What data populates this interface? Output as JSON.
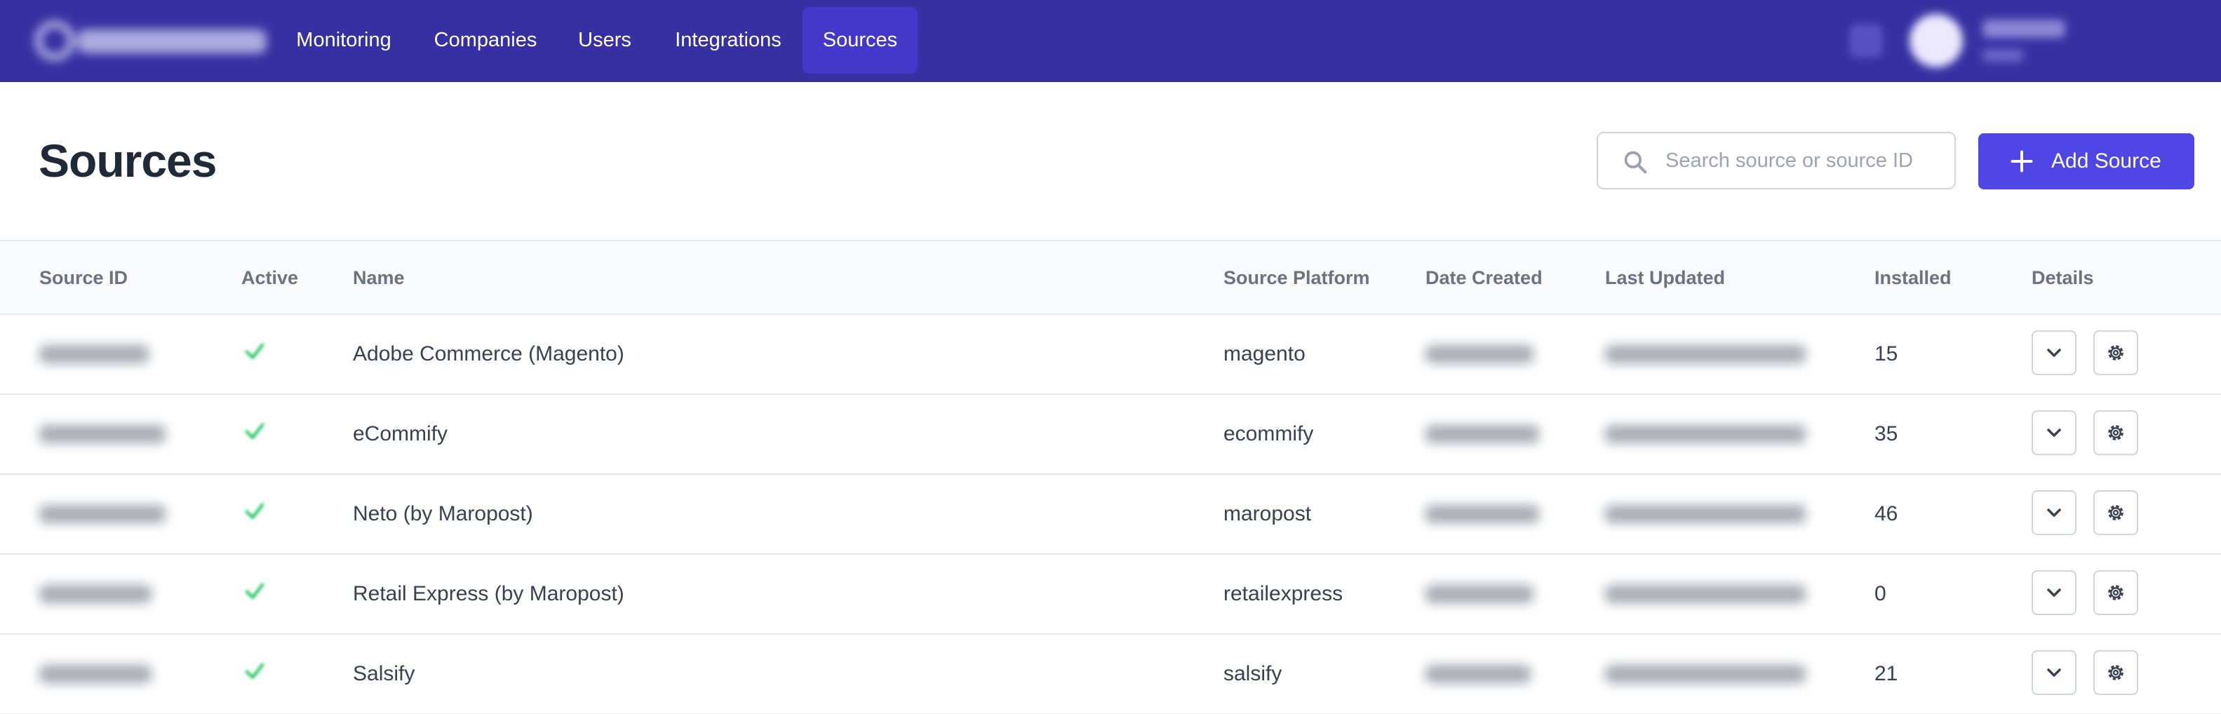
{
  "nav": {
    "items": [
      {
        "label": "Monitoring",
        "active": false
      },
      {
        "label": "Companies",
        "active": false
      },
      {
        "label": "Users",
        "active": false
      },
      {
        "label": "Integrations",
        "active": false
      },
      {
        "label": "Sources",
        "active": true
      }
    ]
  },
  "header": {
    "title": "Sources",
    "search_placeholder": "Search source or source ID",
    "add_button_label": "Add Source"
  },
  "table": {
    "columns": [
      "Source ID",
      "Active",
      "Name",
      "Source Platform",
      "Date Created",
      "Last Updated",
      "Installed",
      "Details"
    ],
    "rows": [
      {
        "name": "Adobe Commerce (Magento)",
        "platform": "magento",
        "installed": "15"
      },
      {
        "name": "eCommify",
        "platform": "ecommify",
        "installed": "35"
      },
      {
        "name": "Neto (by Maropost)",
        "platform": "maropost",
        "installed": "46"
      },
      {
        "name": "Retail Express (by Maropost)",
        "platform": "retailexpress",
        "installed": "0"
      },
      {
        "name": "Salsify",
        "platform": "salsify",
        "installed": "21"
      }
    ]
  },
  "colors": {
    "nav_bg": "#3730a3",
    "nav_active_bg": "#4338ca",
    "primary_button": "#4f46e5",
    "active_check": "#22c55e"
  },
  "icons": [
    "search-icon",
    "plus-icon",
    "check-icon",
    "chevron-down-icon",
    "gear-icon"
  ]
}
